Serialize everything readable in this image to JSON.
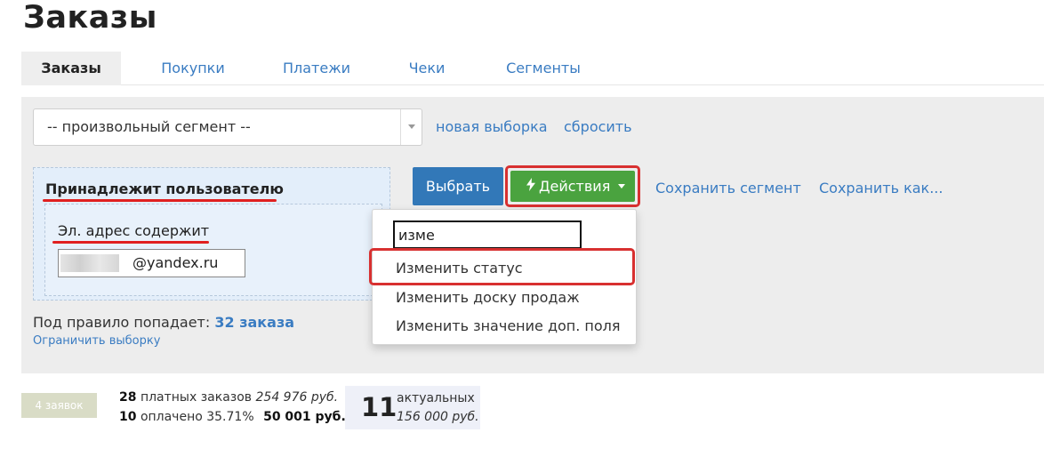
{
  "page": {
    "title": "Заказы"
  },
  "tabs": [
    {
      "label": "Заказы",
      "active": true
    },
    {
      "label": "Покупки"
    },
    {
      "label": "Платежи"
    },
    {
      "label": "Чеки"
    },
    {
      "label": "Сегменты"
    }
  ],
  "filter": {
    "segment_select_value": "-- произвольный сегмент --",
    "new_selection_link": "новая выборка",
    "reset_link": "сбросить",
    "rule": {
      "title": "Принадлежит пользователю",
      "condition_label": "Эл. адрес содержит",
      "condition_value": "@yandex.ru"
    },
    "select_button": "Выбрать",
    "actions_button": "Действия",
    "save_segment_link": "Сохранить сегмент",
    "save_as_link": "Сохранить как...",
    "rule_count_prefix": "Под правило попадает:",
    "rule_count_value": "32 заказа",
    "limit_link": "Ограничить выборку"
  },
  "actions_dropdown": {
    "search_value": "изме",
    "items": [
      "Изменить статус",
      "Изменить доску продаж",
      "Изменить значение доп. поля"
    ]
  },
  "summary": {
    "badge": "4 заявок",
    "paid_orders_count": "28",
    "paid_orders_label": "платных заказов",
    "paid_orders_sum": "254 976 руб.",
    "paid_count": "10",
    "paid_label": "оплачено 35.71%",
    "paid_sum": "50 001 руб.",
    "actual_count": "11",
    "actual_label": "актуальных",
    "actual_sum": "156 000 руб."
  },
  "colors": {
    "accent_link": "#3a7cc2",
    "primary_button": "#3278b8",
    "success_button": "#4aa33f",
    "highlight": "#d83030"
  }
}
